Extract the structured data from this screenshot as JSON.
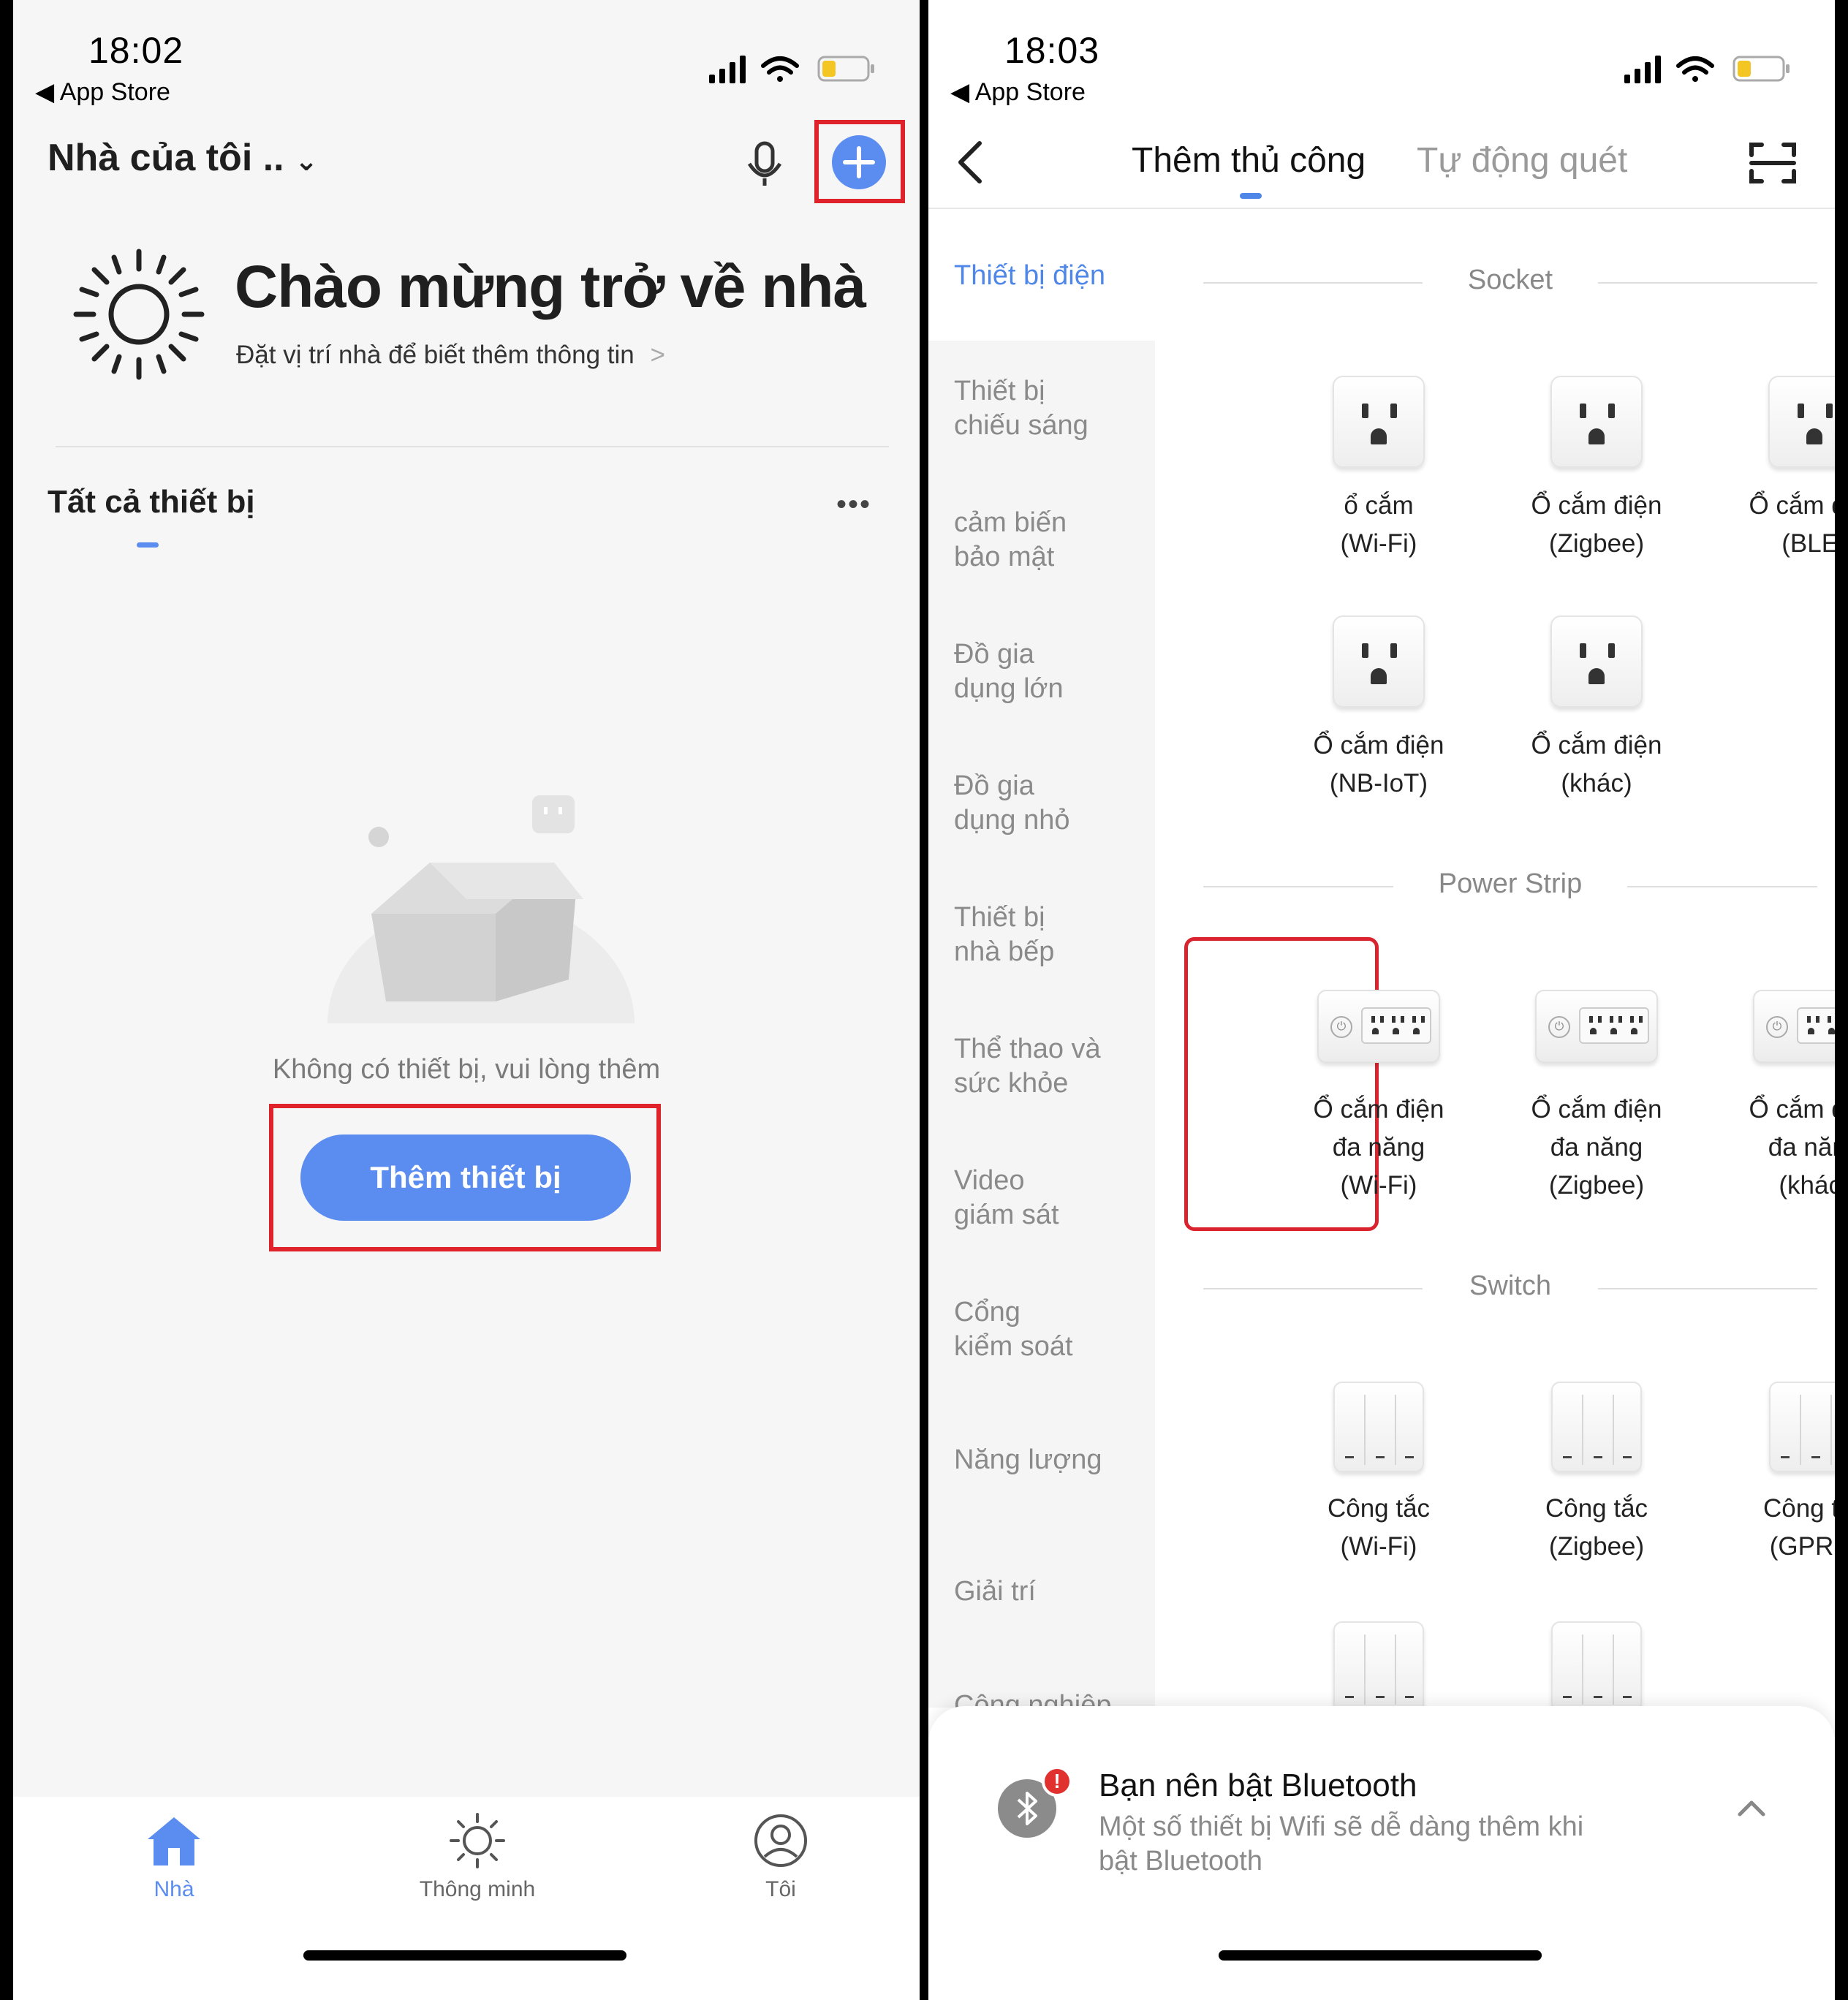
{
  "left": {
    "status": {
      "time": "18:02",
      "back_app": "App Store"
    },
    "header": {
      "home_name": "Nhà của tôi ..",
      "mic_icon": "microphone-icon",
      "add_icon": "plus-circle-icon"
    },
    "welcome": {
      "title": "Chào mừng trở về nhà",
      "subtitle": "Đặt vị trí nhà để biết thêm thông tin"
    },
    "devices": {
      "section_title": "Tất cả thiết bị",
      "empty_text": "Không có thiết bị, vui lòng thêm",
      "add_button": "Thêm thiết bị"
    },
    "tabbar": [
      {
        "label": "Nhà",
        "icon": "home-icon",
        "active": true
      },
      {
        "label": "Thông minh",
        "icon": "sun-icon",
        "active": false
      },
      {
        "label": "Tôi",
        "icon": "profile-icon",
        "active": false
      }
    ]
  },
  "right": {
    "status": {
      "time": "18:03",
      "back_app": "App Store"
    },
    "tabs": {
      "manual": "Thêm thủ công",
      "auto": "Tự động quét"
    },
    "categories": [
      "Thiết bị điện",
      "Thiết bị\nchiếu sáng",
      "cảm biến\nbảo mật",
      "Đồ gia\ndụng lớn",
      "Đồ gia\ndụng nhỏ",
      "Thiết bị\nnhà bếp",
      "Thể thao và\nsức khỏe",
      "Video\ngiám sát",
      "Cổng\nkiểm soát",
      "Năng lượng",
      "Giải trí",
      "Công nghiệp"
    ],
    "sections": {
      "socket": {
        "title": "Socket",
        "items": [
          "ổ cắm\n(Wi-Fi)",
          "Ổ cắm điện\n(Zigbee)",
          "Ổ cắm điện\n(BLE)",
          "Ổ cắm điện\n(NB-IoT)",
          "Ổ cắm điện\n(khác)"
        ]
      },
      "strip": {
        "title": "Power Strip",
        "items": [
          "Ổ cắm điện\nđa năng\n(Wi-Fi)",
          "Ổ cắm điện\nđa năng\n(Zigbee)",
          "Ổ cắm điện\nđa năng\n(khác)"
        ]
      },
      "switch": {
        "title": "Switch",
        "items": [
          "Công tắc\n(Wi-Fi)",
          "Công tắc\n(Zigbee)",
          "Công tắc\n(GPRS)"
        ]
      }
    },
    "bluetooth": {
      "title": "Bạn nên bật Bluetooth",
      "desc": "Một số thiết bị Wifi sẽ dễ dàng thêm khi\nbật Bluetooth",
      "badge": "!"
    }
  },
  "colors": {
    "accent": "#5b8cf0",
    "highlight": "#e0232b",
    "category_active": "#4f87e8"
  }
}
